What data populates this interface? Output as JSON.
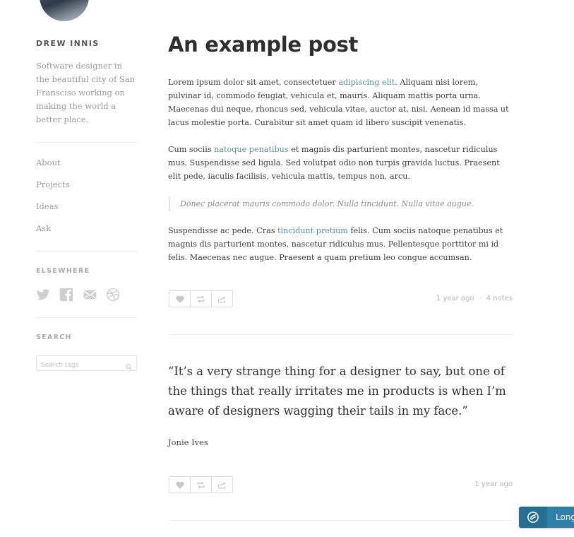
{
  "sidebar": {
    "blog_name": "DREW INNIS",
    "description": "Software designer in the beautiful city of San Fransciso working on making the world a better place.",
    "nav": [
      {
        "label": "About"
      },
      {
        "label": "Projects"
      },
      {
        "label": "Ideas"
      },
      {
        "label": "Ask"
      }
    ],
    "elsewhere_heading": "ELSEWHERE",
    "social_icons": [
      "twitter-icon",
      "facebook-icon",
      "email-icon",
      "dribbble-icon"
    ],
    "search_heading": "SEARCH",
    "search_placeholder": "Search tags",
    "search_value": ""
  },
  "post1": {
    "title": "An example post",
    "p1": {
      "before": "Lorem ipsum dolor sit amet, consectetuer ",
      "link": "adipiscing elit",
      "after": ". Aliquam nisi lorem, pulvinar id, commodo feugiat, vehicula et, mauris. Aliquam mattis porta urna. Maecenas dui neque, rhoncus sed, vehicula vitae, auctor at, nisi. Aenean id massa ut lacus molestie porta. Curabitur sit amet quam id libero suscipit venenatis."
    },
    "p2": {
      "before": "Cum sociis ",
      "link": "natoque penatibus",
      "after": " et magnis dis parturient montes, nascetur ridiculus mus. Suspendisse sed ligula. Sed volutpat odio non turpis gravida luctus. Praesent elit pede, iaculis facilisis, vehicula mattis, tempus non, arcu."
    },
    "blockquote": "Donec placerat mauris commodo dolor. Nulla tincidunt. Nulla vitae augue.",
    "p3": {
      "before": "Suspendisse ac pede. Cras ",
      "link": "tincidunt pretium",
      "after": " felis. Cum sociis natoque penatibus et magnis dis parturient montes, nascetur ridiculus mus. Pellentesque porttitor mi id felis. Maecenas nec augue. Praesent a quam pretium leo congue accumsan."
    },
    "time": "1 year ago",
    "separator": "·",
    "notes": "4 notes"
  },
  "post2": {
    "quote": "“It’s a very strange thing for a designer to say, but one of the things that really irritates me in products is when I’m aware of designers wagging their tails in my face.”",
    "source": "Jonie Ives",
    "time": "1 year ago"
  },
  "floating_button": {
    "label": "Long"
  },
  "colors": {
    "link": "#5c8ea3",
    "button": "#2f7fa6",
    "text": "#3f3f3f",
    "muted": "#999999"
  }
}
